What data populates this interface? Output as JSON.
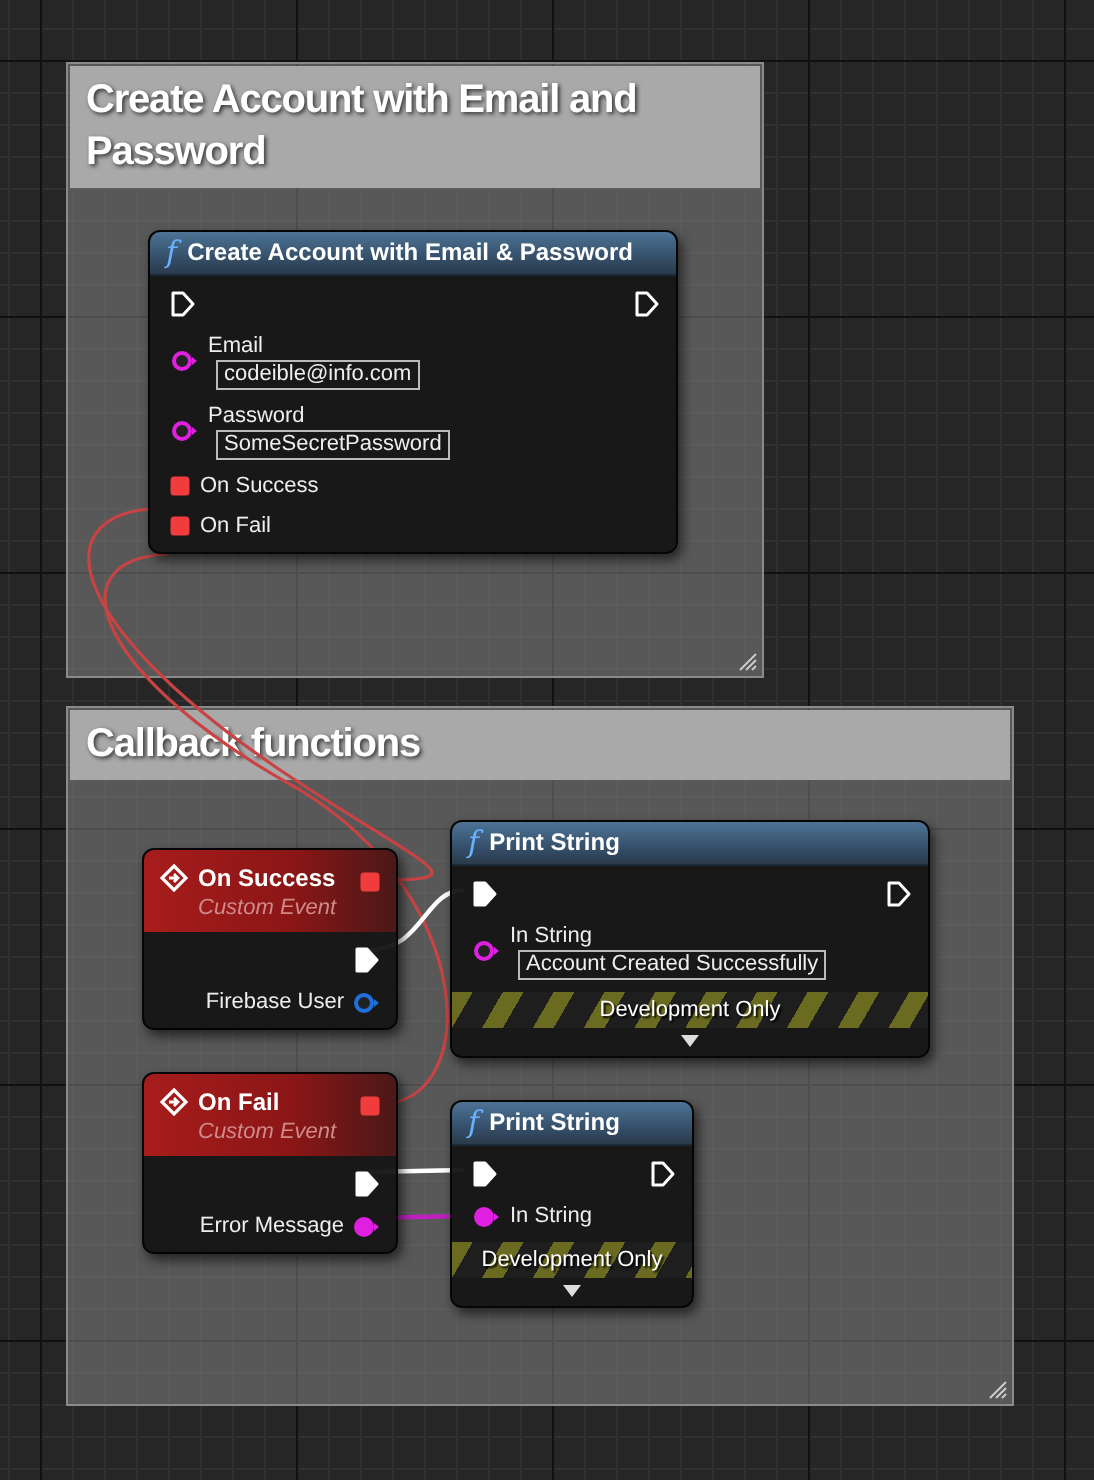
{
  "comments": [
    {
      "title": "Create Account with Email and Password"
    },
    {
      "title": "Callback functions"
    }
  ],
  "nodes": [
    {
      "kind": "function",
      "icon": "f",
      "title": "Create Account with Email & Password",
      "rows": [
        {
          "kind": "exec",
          "in": {
            "kind": "exec",
            "connected": false
          },
          "out": {
            "kind": "exec",
            "connected": false
          }
        },
        {
          "kind": "input",
          "pin": {
            "kind": "string",
            "connected": false
          },
          "label": "Email",
          "value": "codeible@info.com"
        },
        {
          "kind": "input",
          "pin": {
            "kind": "string",
            "connected": false
          },
          "label": "Password",
          "value": "SomeSecretPassword"
        },
        {
          "kind": "input",
          "pin": {
            "kind": "delegate",
            "connected": true
          },
          "label": "On Success"
        },
        {
          "kind": "input",
          "pin": {
            "kind": "delegate",
            "connected": true
          },
          "label": "On Fail"
        }
      ]
    },
    {
      "kind": "event",
      "title": "On Success",
      "subtitle": "Custom Event",
      "header_pin": {
        "kind": "delegate",
        "connected": true
      },
      "rows": [
        {
          "kind": "exec",
          "out": {
            "kind": "exec",
            "connected": true
          }
        },
        {
          "kind": "output",
          "pin": {
            "kind": "object",
            "connected": false
          },
          "label": "Firebase User"
        }
      ]
    },
    {
      "kind": "event",
      "title": "On Fail",
      "subtitle": "Custom Event",
      "header_pin": {
        "kind": "delegate",
        "connected": true
      },
      "rows": [
        {
          "kind": "exec",
          "out": {
            "kind": "exec",
            "connected": true
          }
        },
        {
          "kind": "output",
          "pin": {
            "kind": "string",
            "connected": true
          },
          "label": "Error Message"
        }
      ]
    },
    {
      "kind": "function",
      "icon": "f",
      "title": "Print String",
      "footer": "Development Only",
      "rows": [
        {
          "kind": "exec",
          "in": {
            "kind": "exec",
            "connected": true
          },
          "out": {
            "kind": "exec",
            "connected": false
          }
        },
        {
          "kind": "input",
          "pin": {
            "kind": "string",
            "connected": false
          },
          "label": "In String",
          "value": "Account Created Successfully"
        }
      ]
    },
    {
      "kind": "function",
      "icon": "f",
      "title": "Print String",
      "footer": "Development Only",
      "rows": [
        {
          "kind": "exec",
          "in": {
            "kind": "exec",
            "connected": true
          },
          "out": {
            "kind": "exec",
            "connected": false
          }
        },
        {
          "kind": "input",
          "pin": {
            "kind": "string",
            "connected": true
          },
          "label": "In String"
        }
      ]
    }
  ]
}
